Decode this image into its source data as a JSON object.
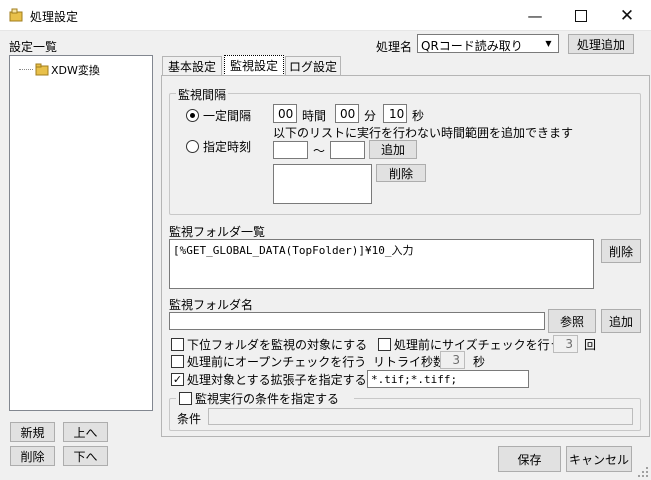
{
  "window": {
    "title": "処理設定",
    "icon": "folder-app-icon"
  },
  "left_panel": {
    "title": "設定一覧",
    "tree_items": [
      {
        "label": "XDW変換"
      }
    ]
  },
  "left_buttons": {
    "new": "新規",
    "up": "上へ",
    "delete": "削除",
    "down": "下へ"
  },
  "header": {
    "process_name_label": "処理名",
    "process_name_value": "QRコード読み取り",
    "add_process": "処理追加"
  },
  "tabs": [
    {
      "label": "基本設定"
    },
    {
      "label": "監視設定"
    },
    {
      "label": "ログ設定"
    }
  ],
  "monitor_interval": {
    "title": "監視間隔",
    "fixed_label": "一定間隔",
    "hours": "00",
    "hours_unit": "時間",
    "minutes": "00",
    "minutes_unit": "分",
    "seconds": "10",
    "seconds_unit": "秒",
    "note": "以下のリストに実行を行わない時間範囲を追加できます",
    "specified_label": "指定時刻",
    "tilde": "～",
    "add": "追加",
    "delete": "削除"
  },
  "folder_list": {
    "title": "監視フォルダ一覧",
    "items": [
      "[%GET_GLOBAL_DATA(TopFolder)]¥10_入力"
    ],
    "delete": "削除"
  },
  "folder_name": {
    "title": "監視フォルダ名",
    "value": "",
    "browse": "参照",
    "add": "追加"
  },
  "options": {
    "subfolders": "下位フォルダを監視の対象にする",
    "size_check": "処理前にサイズチェックを行う",
    "size_check_count": "3",
    "size_check_unit": "回",
    "open_check": "処理前にオープンチェックを行う",
    "retry_label": "リトライ秒数",
    "retry_value": "3",
    "retry_unit": "秒",
    "ext_label": "処理対象とする拡張子を指定する",
    "ext_value": "*.tif;*.tiff;"
  },
  "condition": {
    "title": "監視実行の条件を指定する",
    "label": "条件",
    "value": ""
  },
  "footer": {
    "save": "保存",
    "cancel": "キャンセル"
  }
}
